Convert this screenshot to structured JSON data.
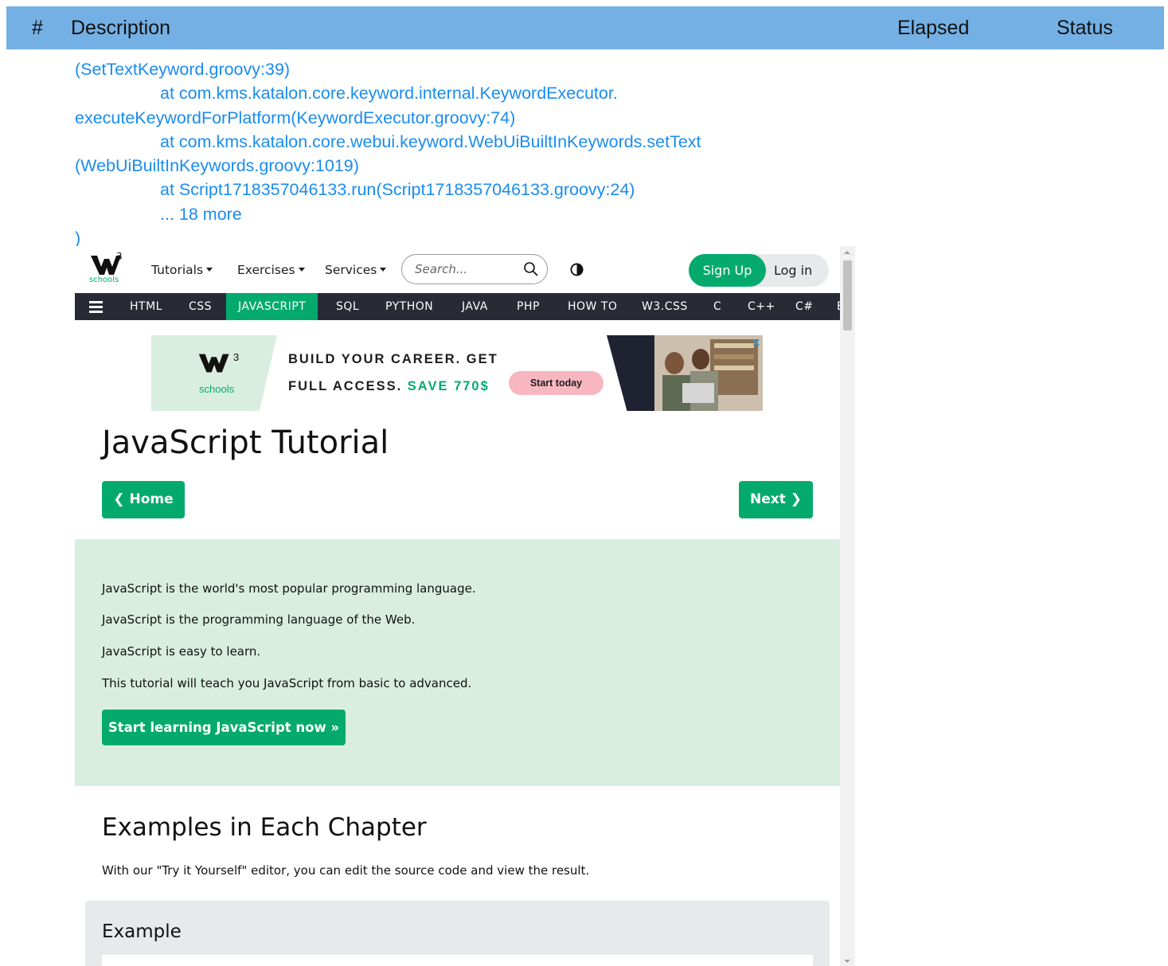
{
  "report": {
    "col_num": "#",
    "col_desc": "Description",
    "col_elapsed": "Elapsed",
    "col_status": "Status"
  },
  "log": [
    "(SetTextKeyword.groovy:39)",
    "at com.kms.katalon.core.keyword.internal.KeywordExecutor.",
    "executeKeywordForPlatform(KeywordExecutor.groovy:74)",
    "at com.kms.katalon.core.webui.keyword.WebUiBuiltInKeywords.setText",
    "(WebUiBuiltInKeywords.groovy:1019)",
    "at Script1718357046133.run(Script1718357046133.groovy:24)",
    "... 18 more",
    ")"
  ],
  "site": {
    "logo_sub": "schools",
    "logo_sup": "3",
    "menu": [
      "Tutorials",
      "Exercises",
      "Services"
    ],
    "search_placeholder": "Search...",
    "signup": "Sign Up",
    "login": "Log in",
    "subnav": [
      "HTML",
      "CSS",
      "JAVASCRIPT",
      "SQL",
      "PYTHON",
      "JAVA",
      "PHP",
      "HOW TO",
      "W3.CSS",
      "C",
      "C++",
      "C#",
      "B"
    ],
    "ad": {
      "line1": "BUILD YOUR CAREER. GET",
      "line2a": "FULL ACCESS.",
      "line2b": "SAVE 770$",
      "button": "Start today",
      "schools": "schools",
      "close": "✕"
    },
    "title": "JavaScript Tutorial",
    "home_btn": "❮ Home",
    "next_btn": "Next ❯",
    "intro": [
      "JavaScript is the world's most popular programming language.",
      "JavaScript is the programming language of the Web.",
      "JavaScript is easy to learn.",
      "This tutorial will teach you JavaScript from basic to advanced."
    ],
    "start_btn": "Start learning JavaScript now »",
    "section_title": "Examples in Each Chapter",
    "section_text": "With our \"Try it Yourself\" editor, you can edit the source code and view the result.",
    "example_label": "Example"
  },
  "colors": {
    "report_header": "#74b0e4",
    "log_text": "#1a8cf0",
    "w3_green": "#04aa6d",
    "w3_dark": "#282a35",
    "intro_bg": "#d9eee1"
  }
}
